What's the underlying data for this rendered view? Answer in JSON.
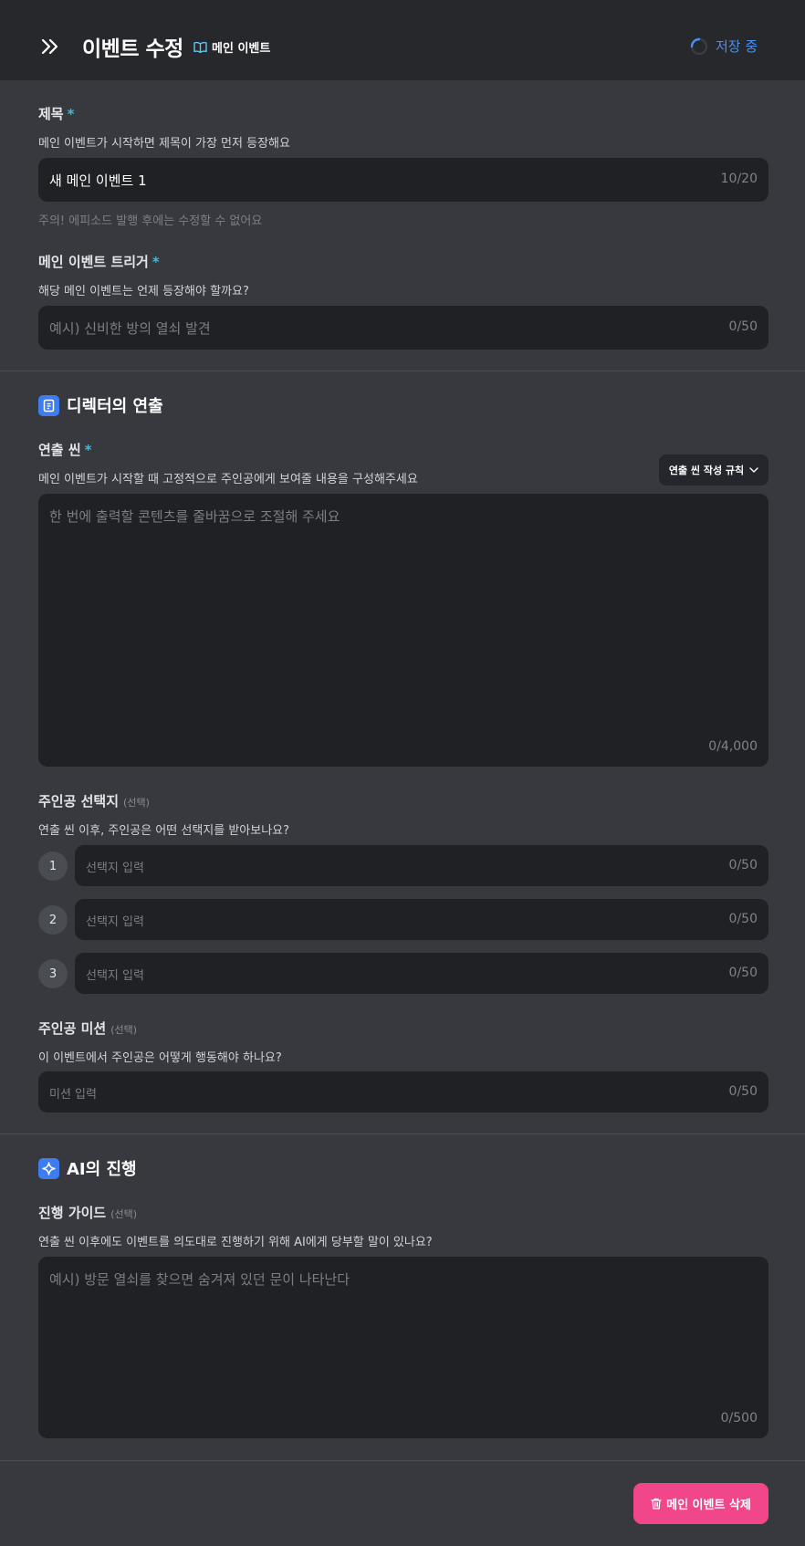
{
  "header": {
    "title": "이벤트 수정",
    "badge_label": "메인 이벤트",
    "status_text": "저장 중"
  },
  "title_field": {
    "label": "제목",
    "required_mark": "*",
    "description": "메인 이벤트가 시작하면 제목이 가장 먼저 등장해요",
    "value": "새 메인 이벤트 1",
    "counter": "10/20",
    "warning": "주의! 에피소드 발행 후에는 수정할 수 없어요"
  },
  "trigger_field": {
    "label": "메인 이벤트 트리거",
    "required_mark": "*",
    "description": "해당 메인 이벤트는 언제 등장해야 할까요?",
    "placeholder": "예시) 신비한 방의 열쇠 발견",
    "counter": "0/50"
  },
  "director_section": {
    "title": "디렉터의 연출",
    "scene": {
      "label": "연출 씬",
      "required_mark": "*",
      "description": "메인 이벤트가 시작할 때 고정적으로 주인공에게 보여줄 내용을 구성해주세요",
      "rules_button": "연출 씬 작성 규칙",
      "placeholder": "한 번에 출력할 콘텐츠를 줄바꿈으로 조절해 주세요",
      "counter": "0/4,000"
    },
    "choices": {
      "label": "주인공 선택지",
      "optional_mark": "(선택)",
      "description": "연출 씬 이후, 주인공은 어떤 선택지를 받아보나요?",
      "items": [
        {
          "number": "1",
          "placeholder": "선택지 입력",
          "counter": "0/50"
        },
        {
          "number": "2",
          "placeholder": "선택지 입력",
          "counter": "0/50"
        },
        {
          "number": "3",
          "placeholder": "선택지 입력",
          "counter": "0/50"
        }
      ]
    },
    "mission": {
      "label": "주인공 미션",
      "optional_mark": "(선택)",
      "description": "이 이벤트에서 주인공은 어떻게 행동해야 하나요?",
      "placeholder": "미션 입력",
      "counter": "0/50"
    }
  },
  "ai_section": {
    "title": "AI의 진행",
    "guide": {
      "label": "진행 가이드",
      "optional_mark": "(선택)",
      "description": "연출 씬 이후에도 이벤트를 의도대로 진행하기 위해 AI에게 당부할 말이 있나요?",
      "placeholder": "예시) 방문 열쇠를 찾으면 숨겨져 있던 문이 나타난다",
      "counter": "0/500"
    }
  },
  "footer": {
    "delete_button": "메인 이벤트 삭제"
  },
  "icons": {
    "collapse": "double-chevron-right-icon",
    "badge": "book-open-icon",
    "status": "spinner-icon",
    "director": "clipboard-icon",
    "ai": "sparkle-icon",
    "rules": "chevron-down-icon",
    "delete": "trash-icon"
  },
  "colors": {
    "accent": "#4b8ef0",
    "required": "#2ec3e0",
    "danger": "#f2468b",
    "section_icon": "#3d7df0"
  }
}
